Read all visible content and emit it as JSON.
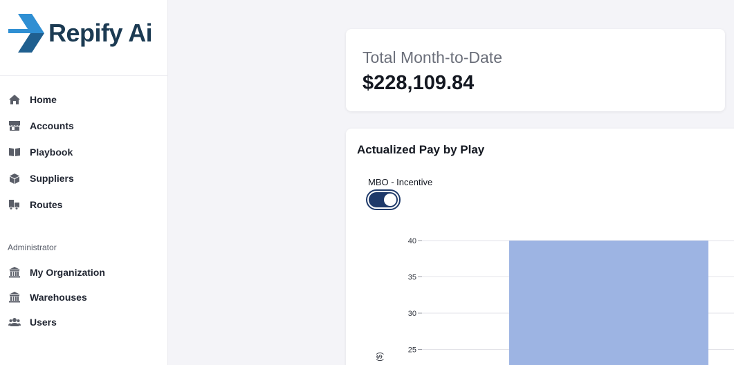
{
  "brand": {
    "name": "Repify Ai",
    "primary_color": "#1b3a52",
    "accent_color": "#2f8fd3"
  },
  "sidebar": {
    "items": [
      {
        "label": "Home",
        "icon": "home-icon"
      },
      {
        "label": "Accounts",
        "icon": "storefront-icon"
      },
      {
        "label": "Playbook",
        "icon": "book-icon"
      },
      {
        "label": "Suppliers",
        "icon": "cube-icon"
      },
      {
        "label": "Routes",
        "icon": "truck-icon"
      }
    ],
    "admin_title": "Administrator",
    "admin_items": [
      {
        "label": "My Organization",
        "icon": "bank-icon"
      },
      {
        "label": "Warehouses",
        "icon": "bank-icon"
      },
      {
        "label": "Users",
        "icon": "users-icon"
      }
    ]
  },
  "summary": {
    "title": "Total Month-to-Date",
    "value": "$228,109.84"
  },
  "chart": {
    "title": "Actualized Pay by Play",
    "toggle_label": "MBO - Incentive",
    "toggle_on": true
  },
  "chart_data": {
    "type": "bar",
    "title": "Actualized Pay by Play",
    "ylabel": "($)",
    "yticks": [
      40,
      35,
      30,
      25
    ],
    "ylim_visible": [
      25,
      40
    ],
    "series": [
      {
        "values": [
          40
        ],
        "color": "#9db4e3"
      }
    ],
    "grid": true
  }
}
